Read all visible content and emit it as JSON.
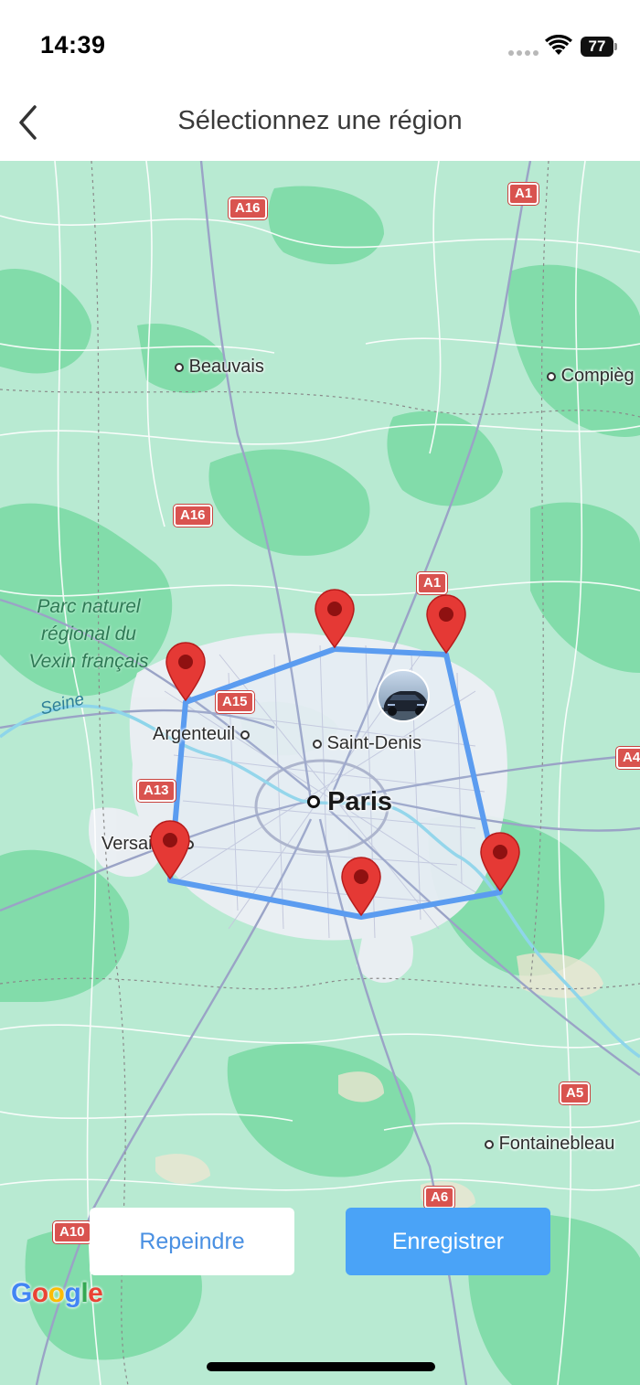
{
  "status_bar": {
    "time": "14:39",
    "battery": "77"
  },
  "header": {
    "title": "Sélectionnez une région"
  },
  "map": {
    "places": {
      "beauvais": "Beauvais",
      "compiegne": "Compièg",
      "argenteuil": "Argenteuil",
      "saint_denis": "Saint-Denis",
      "paris": "Paris",
      "versailles": "Versailles",
      "fontainebleau": "Fontainebleau"
    },
    "park": {
      "line1": "Parc naturel",
      "line2": "régional du",
      "line3": "Vexin français"
    },
    "river": "Seine",
    "roads": {
      "a16_top": "A16",
      "a1_top": "A1",
      "a16_mid": "A16",
      "a1_mid": "A1",
      "a15": "A15",
      "a13": "A13",
      "a4": "A4",
      "a5": "A5",
      "a6": "A6",
      "a10": "A10"
    },
    "polygon_pin_count": 6,
    "colors": {
      "polygon": "#5b9cf0",
      "pin": "#e53935",
      "water": "#8ed5ea",
      "park": "#77d8a6",
      "urban": "#eeeff5"
    }
  },
  "actions": {
    "repaint_label": "Repeindre",
    "save_label": "Enregistrer"
  },
  "attribution": {
    "g": "G",
    "o1": "o",
    "o2": "o",
    "g2": "g",
    "l": "l",
    "e": "e"
  }
}
